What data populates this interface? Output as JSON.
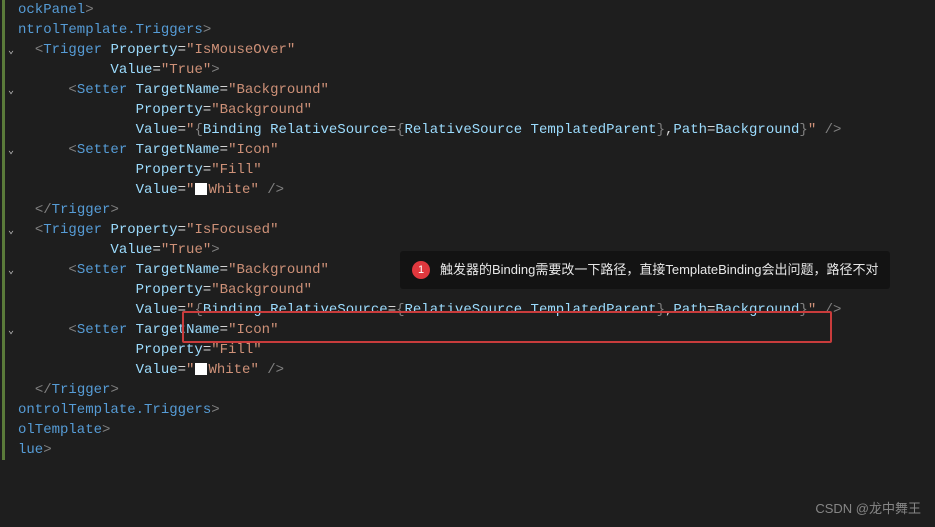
{
  "lines": {
    "l1": {
      "pre": "",
      "tag": "ockPanel",
      "punct_close": ">"
    },
    "l2": {
      "pre": "",
      "tag": "ntrolTemplate.Triggers",
      "punct_close": ">"
    },
    "l3": {
      "pre": "<",
      "tag": "Trigger",
      "attr": "Property",
      "val": "\"IsMouseOver\""
    },
    "l4": {
      "attr": "Value",
      "val": "\"True\"",
      "punct_close": ">"
    },
    "l5": {
      "pre": "<",
      "tag": "Setter",
      "attr": "TargetName",
      "val": "\"Background\""
    },
    "l6": {
      "attr": "Property",
      "val": "\"Background\""
    },
    "l7": {
      "attr": "Value",
      "val_open": "\"",
      "bind_open": "{",
      "bind1": "Binding ",
      "bind2": "RelativeSource",
      "eq": "=",
      "bind_brace": "{",
      "bind3": "RelativeSource ",
      "bind4": "TemplatedParent",
      "bind_brace_close": "}",
      "comma": ",",
      "bind5": "Path",
      "eq2": "=",
      "bind6": "Background",
      "bind_close": "}",
      "val_close": "\"",
      "self_close": " />"
    },
    "l8": {
      "pre": "<",
      "tag": "Setter",
      "attr": "TargetName",
      "val": "\"Icon\""
    },
    "l9": {
      "attr": "Property",
      "val": "\"Fill\""
    },
    "l10": {
      "attr": "Value",
      "val_open": "\"",
      "val_text": "White",
      "val_close": "\"",
      "self_close": " />"
    },
    "l11": {
      "pre": "</",
      "tag": "Trigger",
      "punct_close": ">"
    },
    "l12": {
      "pre": "<",
      "tag": "Trigger",
      "attr": "Property",
      "val": "\"IsFocused\""
    },
    "l13": {
      "attr": "Value",
      "val": "\"True\"",
      "punct_close": ">"
    },
    "l14": {
      "pre": "<",
      "tag": "Setter",
      "attr": "TargetName",
      "val": "\"Background\""
    },
    "l15": {
      "attr": "Property",
      "val": "\"Background\""
    },
    "l16": {
      "attr": "Value",
      "val_open": "\"",
      "bind_open": "{",
      "bind1": "Binding ",
      "bind2": "RelativeSource",
      "eq": "=",
      "bind_brace": "{",
      "bind3": "RelativeSource ",
      "bind4": "TemplatedParent",
      "bind_brace_close": "}",
      "comma": ",",
      "bind5": "Path",
      "eq2": "=",
      "bind6": "Background",
      "bind_close": "}",
      "val_close": "\"",
      "self_close": " />"
    },
    "l17": {
      "pre": "<",
      "tag": "Setter",
      "attr": "TargetName",
      "val": "\"Icon\""
    },
    "l18": {
      "attr": "Property",
      "val": "\"Fill\""
    },
    "l19": {
      "attr": "Value",
      "val_open": "\"",
      "val_text": "White",
      "val_close": "\"",
      "self_close": " />"
    },
    "l20": {
      "pre": "</",
      "tag": "Trigger",
      "punct_close": ">"
    },
    "l21": {
      "tag": "ontrolTemplate.Triggers",
      "punct_close": ">"
    },
    "l22": {
      "tag": "olTemplate",
      "punct_close": ">"
    },
    "l23": {
      "tag": "lue",
      "punct_close": ">"
    }
  },
  "callout": {
    "badge": "1",
    "text": "触发器的Binding需要改一下路径，直接TemplateBinding会出问题，路径不对"
  },
  "watermark": "CSDN @龙中舞王"
}
